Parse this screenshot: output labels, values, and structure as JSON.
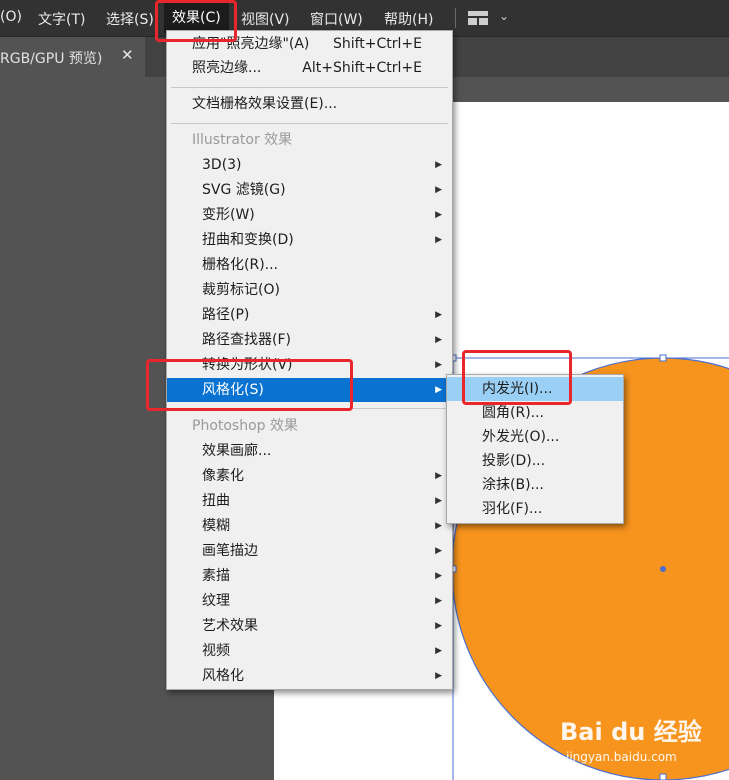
{
  "menubar": {
    "items": [
      "(O)",
      "文字(T)",
      "选择(S)",
      "效果(C)",
      "视图(V)",
      "窗口(W)",
      "帮助(H)"
    ],
    "workspace_switcher_icon": "workspace-layout-icon",
    "workspace_chevron": "⌄"
  },
  "document_tab": {
    "label": "RGB/GPU 预览)",
    "close": "✕"
  },
  "effect_menu": {
    "apply_last": {
      "label": "应用\"照亮边缘\"(A)",
      "shortcut": "Shift+Ctrl+E"
    },
    "last_effect": {
      "label": "照亮边缘...",
      "shortcut": "Alt+Shift+Ctrl+E"
    },
    "raster_settings": "文档栅格效果设置(E)...",
    "illustrator_header": "Illustrator 效果",
    "illustrator_items": [
      "3D(3)",
      "SVG 滤镜(G)",
      "变形(W)",
      "扭曲和变换(D)",
      "栅格化(R)...",
      "裁剪标记(O)",
      "路径(P)",
      "路径查找器(F)",
      "转换为形状(V)",
      "风格化(S)"
    ],
    "photoshop_header": "Photoshop 效果",
    "photoshop_items": [
      "效果画廊...",
      "像素化",
      "扭曲",
      "模糊",
      "画笔描边",
      "素描",
      "纹理",
      "艺术效果",
      "视频",
      "风格化"
    ]
  },
  "stylize_submenu": {
    "items": [
      "内发光(I)...",
      "圆角(R)...",
      "外发光(O)...",
      "投影(D)...",
      "涂抹(B)...",
      "羽化(F)..."
    ]
  },
  "artwork": {
    "circle_fill": "#F7941D",
    "circle_stroke": "#4A6FD1",
    "selection_color": "#4A6FD1"
  },
  "highlight_color": "#E8262C",
  "menu_selected_color": "#0A73D2",
  "submenu_hover_color": "#9AD0F5",
  "watermark": {
    "logo": "Bai du 经验",
    "url": "jingyan.baidu.com"
  }
}
